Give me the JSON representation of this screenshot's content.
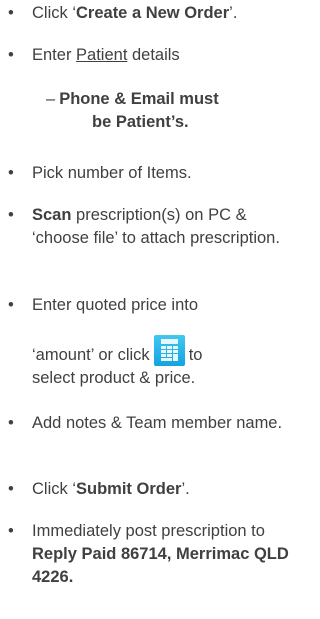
{
  "steps": [
    {
      "pre": "Click ‘",
      "bold": "Create a New Order",
      "post": "’."
    },
    {
      "pre": "Enter ",
      "underlined": "Patient",
      "post": " details"
    },
    {
      "dash": "–",
      "bold_line1": "Phone & Email must",
      "bold_line2": "be Patient’s."
    },
    {
      "text": "Pick number of Items."
    },
    {
      "bold": "Scan",
      "post": " prescription(s) on PC & ‘choose file’ to attach prescription."
    },
    {
      "line1": "Enter quoted price into",
      "pre": "‘amount’ or click",
      "post": "to",
      "line3": "select product & price.",
      "icon": "calculator-icon"
    },
    {
      "text": "Add notes & Team member name."
    },
    {
      "pre": "Click ‘",
      "bold": "Submit Order",
      "post": "’."
    },
    {
      "pre": "Immediately post prescription to ",
      "bold": "Reply Paid 86714, Merrimac QLD 4226."
    }
  ],
  "bullet_char": "•",
  "colors": {
    "text": "#404040",
    "icon": "#12a4e0"
  }
}
